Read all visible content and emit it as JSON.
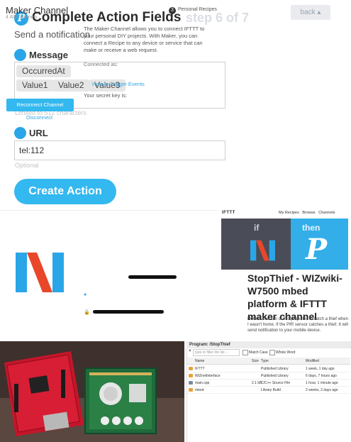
{
  "header": {
    "title": "Complete Action Fields",
    "step": "step 6 of 7",
    "back_label": "back ▴",
    "subtitle": "Send a notification"
  },
  "message": {
    "label": "Message",
    "chips": [
      "OccurredAt",
      "Value1",
      "Value2",
      "Value3"
    ],
    "hint": "Limited to 512 characters"
  },
  "url": {
    "label": "URL",
    "value": "tel:112",
    "hint": "Optional"
  },
  "create_label": "Create Action",
  "maker": {
    "title": "Maker Channel",
    "subtitle": "4 All Channels",
    "recipes_count": "3",
    "recipes_label": "Personal Recipes",
    "description": "The Maker Channel allows you to connect IFTTT to your personal DIY projects. With Maker, you can connect a Recipe to any device or service that can make or receive a web request.",
    "connected_label": "Connected as:",
    "trigger_link": "How to Trigger Events",
    "secret_label": "Your secret key is:",
    "reconnect_label": "Reconnect Channel",
    "disconnect_label": "Disconnect"
  },
  "article": {
    "brand": "IFTTT",
    "nav": [
      "My Recipes",
      "Browse",
      "Channels"
    ],
    "if_label": "if",
    "then_label": "then",
    "title": "StopThief - WIZwiki-W7500 mbed platform & IFTTT maker channel",
    "notes_label": "Notes:",
    "notes": "The aim of this project is to catch a thief when I wasn't home. If the PIR sensor catches a thief. It will send notification to your mobile device."
  },
  "files": {
    "header": "Program: /StopThief",
    "filter_placeholder": "type to filter the list ...",
    "match_case": "Match Case",
    "whole_word": "Whole Word",
    "columns": [
      "Name",
      "Size",
      "Type",
      "Modified"
    ],
    "rows": [
      {
        "name": "IFTTT",
        "size": "",
        "type": "Published Library",
        "modified": "1 week, 1 day ago",
        "icon_color": "#e8a23a"
      },
      {
        "name": "WIZnetInterface",
        "size": "",
        "type": "Published Library",
        "modified": "6 days, 7 hours ago",
        "icon_color": "#e8a23a"
      },
      {
        "name": "main.cpp",
        "size": "2.1 kB",
        "type": "C/C++ Source File",
        "modified": "1 hour, 1 minute ago",
        "icon_color": "#7a8aa0"
      },
      {
        "name": "mbed",
        "size": "",
        "type": "Library Build",
        "modified": "2 weeks, 2 days ago",
        "icon_color": "#e8a23a"
      }
    ]
  },
  "colors": {
    "accent": "#33b8ef",
    "maker_orange": "#e8472a",
    "maker_blue": "#2aa6e8"
  }
}
